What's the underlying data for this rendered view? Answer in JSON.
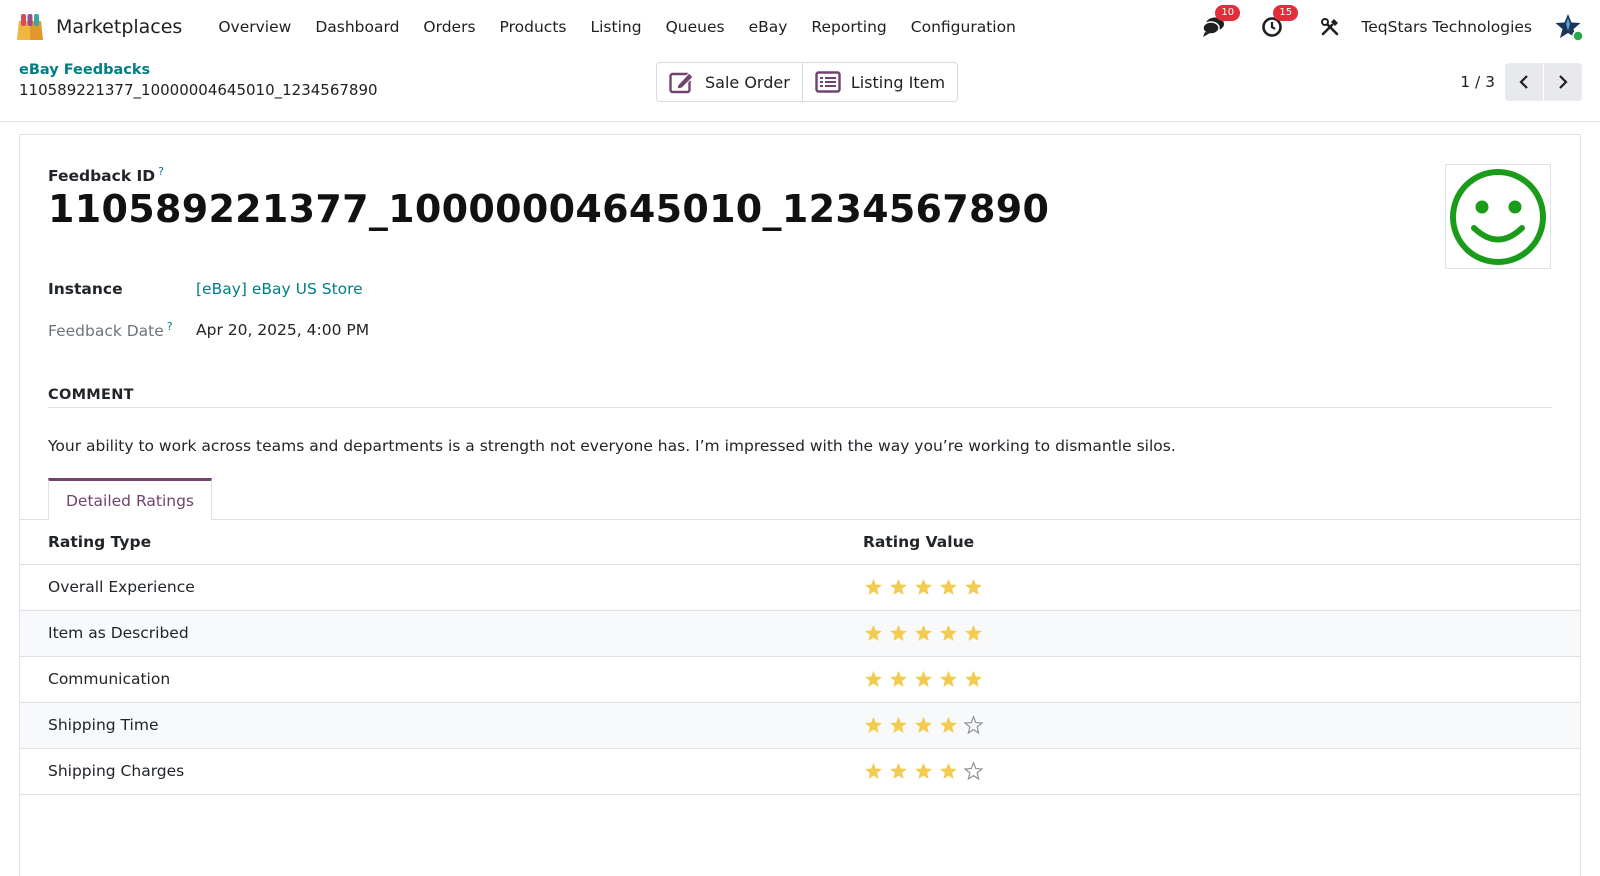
{
  "navbar": {
    "app_name": "Marketplaces",
    "menu": [
      "Overview",
      "Dashboard",
      "Orders",
      "Products",
      "Listing",
      "Queues",
      "eBay",
      "Reporting",
      "Configuration"
    ],
    "messages_count": "10",
    "activities_count": "15",
    "company": "TeqStars Technologies"
  },
  "breadcrumb": {
    "parent": "eBay Feedbacks",
    "current": "110589221377_10000004645010_1234567890"
  },
  "smart_buttons": {
    "sale_order": "Sale Order",
    "listing_item": "Listing Item"
  },
  "pager": {
    "value": "1 / 3"
  },
  "form": {
    "title_label": "Feedback ID",
    "help_mark": "?",
    "title": "110589221377_10000004645010_1234567890",
    "instance_label": "Instance",
    "instance_value": "[eBay] eBay US Store",
    "date_label": "Feedback Date",
    "date_value": "Apr 20, 2025, 4:00 PM",
    "comment_header": "COMMENT",
    "comment": "Your ability to work across teams and departments is a strength not everyone has. I’m impressed with the way you’re working to dismantle silos.",
    "sentiment_icon": "smiley-face-green"
  },
  "notebook": {
    "tab": "Detailed Ratings",
    "columns": [
      "Rating Type",
      "Rating Value"
    ],
    "rows": [
      {
        "type": "Overall Experience",
        "stars": 5
      },
      {
        "type": "Item as Described",
        "stars": 5
      },
      {
        "type": "Communication",
        "stars": 5
      },
      {
        "type": "Shipping Time",
        "stars": 4
      },
      {
        "type": "Shipping Charges",
        "stars": 4
      }
    ],
    "max_stars": 5
  },
  "colors": {
    "accent": "#71436f",
    "link": "#017e84",
    "badge": "#e02f3a",
    "star_filled": "#f3cc4f",
    "smiley": "#1a9c1a"
  }
}
